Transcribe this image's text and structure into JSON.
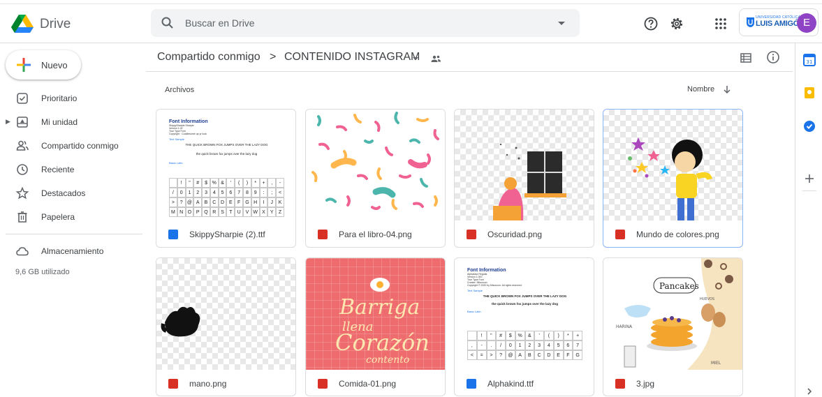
{
  "app": {
    "name": "Drive"
  },
  "search": {
    "placeholder": "Buscar en Drive"
  },
  "account": {
    "org_line1": "UNIVERSIDAD CATÓLICA",
    "org_line2": "LUIS AMIGÓ",
    "avatar_letter": "E",
    "avatar_color": "#8e44c4"
  },
  "sidebar": {
    "new_label": "Nuevo",
    "items": [
      {
        "label": "Prioritario",
        "icon": "priority-check-icon"
      },
      {
        "label": "Mi unidad",
        "icon": "my-drive-icon"
      },
      {
        "label": "Compartido conmigo",
        "icon": "shared-people-icon"
      },
      {
        "label": "Reciente",
        "icon": "clock-icon"
      },
      {
        "label": "Destacados",
        "icon": "star-icon"
      },
      {
        "label": "Papelera",
        "icon": "trash-icon"
      },
      {
        "label": "Almacenamiento",
        "icon": "cloud-icon"
      }
    ],
    "storage_used": "9,6 GB utilizado"
  },
  "breadcrumb": {
    "parent": "Compartido conmigo",
    "separator": ">",
    "current": "CONTENIDO INSTAGRAM"
  },
  "section_title": "Archivos",
  "sort": {
    "label": "Nombre",
    "direction": "ascending"
  },
  "files": [
    {
      "name": "SkippySharpie (2).ttf",
      "type": "font",
      "selected": false
    },
    {
      "name": "Para el libro-04.png",
      "type": "image",
      "selected": false
    },
    {
      "name": "Oscuridad.png",
      "type": "image",
      "selected": false
    },
    {
      "name": "Mundo de colores.png",
      "type": "image",
      "selected": true
    },
    {
      "name": "mano.png",
      "type": "image",
      "selected": false
    },
    {
      "name": "Comida-01.png",
      "type": "image",
      "selected": false
    },
    {
      "name": "Alphakind.ttf",
      "type": "font",
      "selected": false
    },
    {
      "name": "3.jpg",
      "type": "image",
      "selected": false
    }
  ],
  "thumbs": {
    "font1": {
      "title": "Font Information",
      "l1": "SkippySharpie Sharpie",
      "l2": "Version 1.00",
      "l3": "True Type Font",
      "l4": "Copyright · Cuddlesome up yr look",
      "sample_label": "Text Sample",
      "s1": "THE QUICK BROWN FOX JUMPS OVER THE LAZY DOG",
      "s2": "the quick brown fox jumps over the lazy dog",
      "basic": "Basic Latin"
    },
    "font2": {
      "title": "Font Information",
      "l1": "Alphakind Regular",
      "l2": "Version 1.000",
      "l3": "True Type Font",
      "l4": "Creator: Misoncon",
      "l5": "Copyright © 2020 by Misoncon. All rights reserved.",
      "sample_label": "Text Sample",
      "s1": "THE QUICK BROWN FOX JUMPS OVER THE LAZY DOG",
      "s2": "the quick brown fox jumps over the lazy dog",
      "basic": "Basic Latin"
    },
    "comida": {
      "w1": "Barriga",
      "w2": "llena",
      "w3": "Corazón",
      "w4": "contento"
    },
    "pancakes": {
      "title": "Pancakes",
      "huevos": "HUEVOS",
      "harina": "HARINA",
      "miel": "MIEL"
    }
  },
  "colors": {
    "image_icon": "#d93025",
    "font_icon": "#1a73e8",
    "accent": "#1a73e8",
    "selected_border": "#8ab4f8"
  }
}
